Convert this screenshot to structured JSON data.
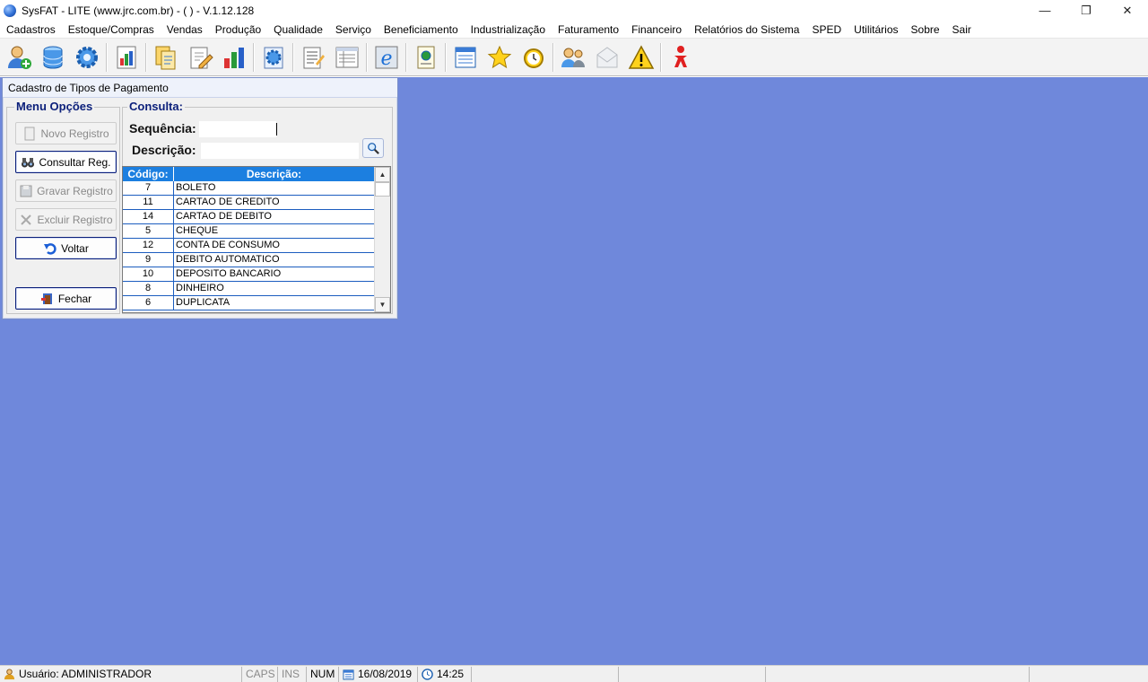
{
  "window": {
    "title": "SysFAT - LITE (www.jrc.com.br) - (                          ) - V.1.12.128",
    "minimize": "—",
    "restore": "❐",
    "close": "✕"
  },
  "menu": [
    "Cadastros",
    "Estoque/Compras",
    "Vendas",
    "Produção",
    "Qualidade",
    "Serviço",
    "Beneficiamento",
    "Industrialização",
    "Faturamento",
    "Financeiro",
    "Relatórios do Sistema",
    "SPED",
    "Utilitários",
    "Sobre",
    "Sair"
  ],
  "toolbar": {
    "icons": [
      "user-add-icon",
      "database-icon",
      "gear-icon",
      "report-chart-icon",
      "documents-icon",
      "edit-document-icon",
      "bar-chart-icon",
      "settings-document-icon",
      "notepad-icon",
      "list-icon",
      "internet-explorer-icon",
      "web-document-icon",
      "calculator-sheet-icon",
      "star-icon",
      "alarm-clock-icon",
      "users-chat-icon",
      "mail-icon",
      "warning-icon",
      "logout-person-icon"
    ]
  },
  "child": {
    "title": "Cadastro de Tipos de Pagamento",
    "menu_legend": "Menu Opções",
    "consulta_legend": "Consulta:",
    "buttons": {
      "novo": "Novo Registro",
      "consultar": "Consultar Reg.",
      "gravar": "Gravar Registro",
      "excluir": "Excluir Registro",
      "voltar": "Voltar",
      "fechar": "Fechar"
    },
    "sequencia_label": "Sequência:",
    "sequencia_value": "",
    "descricao_label": "Descrição:",
    "descricao_value": "",
    "grid": {
      "headers": [
        "Código:",
        "Descrição:"
      ],
      "rows": [
        {
          "code": "7",
          "desc": "BOLETO"
        },
        {
          "code": "11",
          "desc": "CARTAO DE CREDITO"
        },
        {
          "code": "14",
          "desc": "CARTAO DE DEBITO"
        },
        {
          "code": "5",
          "desc": "CHEQUE"
        },
        {
          "code": "12",
          "desc": "CONTA DE CONSUMO"
        },
        {
          "code": "9",
          "desc": "DEBITO AUTOMATICO"
        },
        {
          "code": "10",
          "desc": "DEPOSITO BANCARIO"
        },
        {
          "code": "8",
          "desc": "DINHEIRO"
        },
        {
          "code": "6",
          "desc": "DUPLICATA"
        }
      ]
    }
  },
  "status": {
    "user": "Usuário: ADMINISTRADOR",
    "caps": "CAPS",
    "ins": "INS",
    "num": "NUM",
    "date": "16/08/2019",
    "time": "14:25"
  },
  "colors": {
    "mdi_background": "#6f88db",
    "grid_header": "#1c7fe0",
    "legend_text": "#0b1f7a"
  }
}
